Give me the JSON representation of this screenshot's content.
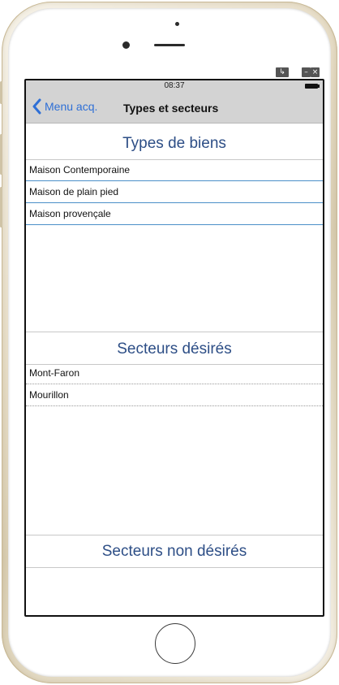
{
  "window_buttons": [
    "↳",
    "–",
    "×"
  ],
  "status": {
    "time": "08:37"
  },
  "nav": {
    "back_label": "Menu acq.",
    "title": "Types et secteurs"
  },
  "types": {
    "header": "Types de biens",
    "items": [
      "Maison Contemporaine",
      "Maison de plain pied",
      "Maison provençale"
    ]
  },
  "secteurs": {
    "header": "Secteurs désirés",
    "items": [
      "Mont-Faron",
      "Mourillon"
    ]
  },
  "non_desires": {
    "header": "Secteurs non désirés"
  },
  "colors": {
    "accent": "#2e6fd6",
    "section_header": "#2d4e86",
    "row_border": "#4a8fc8"
  }
}
